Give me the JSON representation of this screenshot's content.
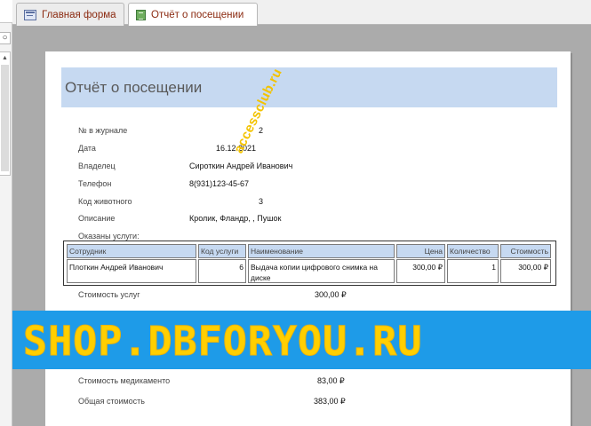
{
  "tabs": [
    {
      "label": "Главная форма",
      "icon": "form-icon"
    },
    {
      "label": "Отчёт о посещении",
      "icon": "report-icon"
    }
  ],
  "nav": {
    "search_icon_glyph": "○",
    "scroll_up_glyph": "▲"
  },
  "report": {
    "title": "Отчёт о посещении",
    "fields": {
      "journal_label": "№ в журнале",
      "journal_value": "2",
      "date_label": "Дата",
      "date_value": "16.12.2021",
      "owner_label": "Владелец",
      "owner_value": "Сироткин Андрей Иванович",
      "phone_label": "Телефон",
      "phone_value": "8(931)123-45-67",
      "animal_label": "Код животного",
      "animal_value": "3",
      "desc_label": "Описание",
      "desc_value": "Кролик, Фландр, , Пушок",
      "services_label": "Оказаны услуги:"
    },
    "services_table": {
      "columns": [
        "Сотрудник",
        "Код услуги",
        "Наименование",
        "Цена",
        "Количество",
        "Стоимость"
      ],
      "rows": [
        [
          "Плоткин Андрей Иванович",
          "6",
          "Выдача копии цифрового снимка на диске",
          "300,00 ₽",
          "1",
          "300,00 ₽"
        ]
      ]
    },
    "totals": {
      "services_label": "Стоимость услуг",
      "services_value": "300,00 ₽",
      "medicine_label": "Стоимость медикаменто",
      "medicine_value": "83,00 ₽",
      "total_label": "Общая стоимость",
      "total_value": "383,00 ₽"
    }
  },
  "watermarks": {
    "diagonal": "accessclub.ru",
    "banner": "SHOP.DBFORYOU.RU"
  },
  "colors": {
    "title_band": "#c6d9f1",
    "banner_bg": "#1e9be8",
    "banner_text": "#ffcf00",
    "tab_text": "#8b2a10"
  }
}
